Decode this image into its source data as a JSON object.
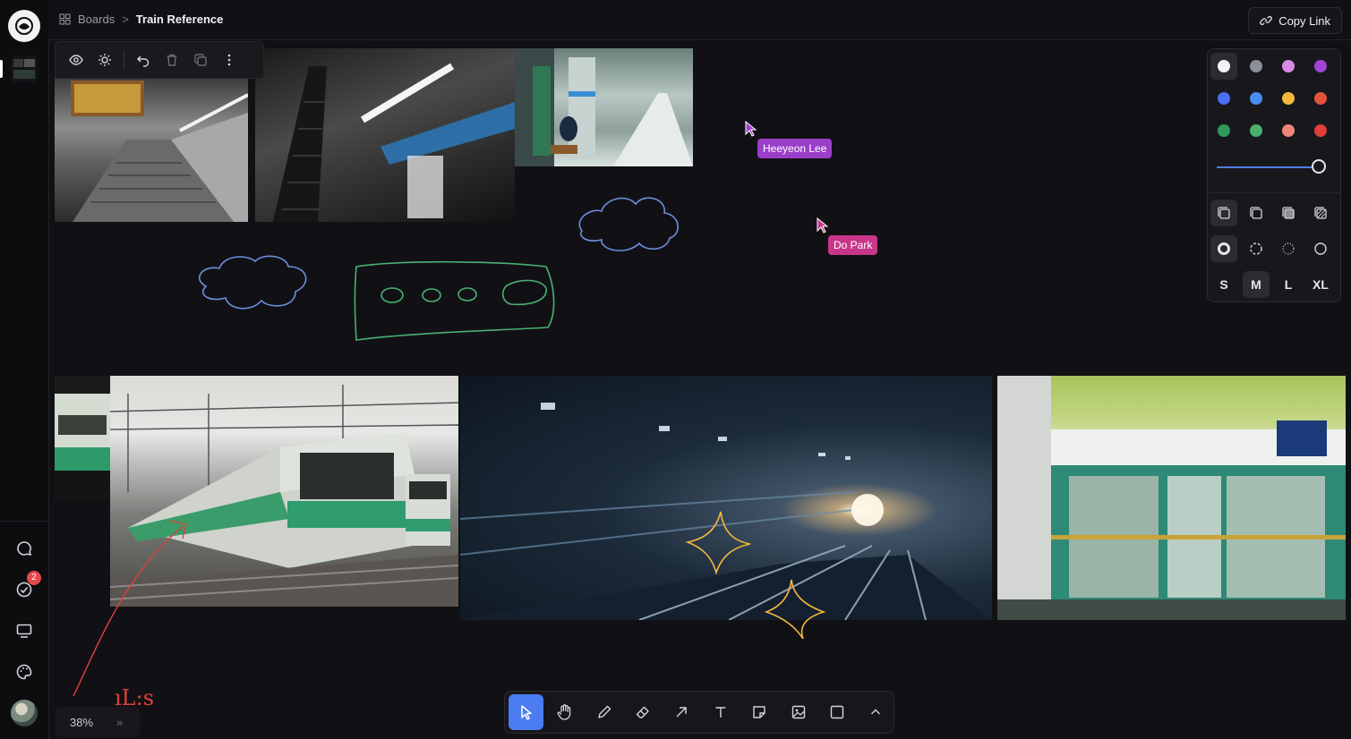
{
  "breadcrumb": {
    "root": "Boards",
    "separator": ">",
    "title": "Train Reference"
  },
  "header": {
    "copy_link": "Copy Link"
  },
  "rail": {
    "tasks_badge": "2"
  },
  "collaborators": [
    {
      "name": "Heeyeon Lee",
      "color": "#9b3fc9"
    },
    {
      "name": "Do Park",
      "color": "#c8368a"
    }
  ],
  "style_panel": {
    "colors": [
      "#f2f2f4",
      "#8b8f98",
      "#d78be6",
      "#a044d4",
      "#4b6ef2",
      "#4a8df2",
      "#f5b83d",
      "#e5533d",
      "#2f9a5b",
      "#49b070",
      "#ef8479",
      "#e0403a"
    ],
    "selected_color": "#f2f2f4",
    "opacity": 1.0,
    "sizes": [
      "S",
      "M",
      "L",
      "XL"
    ],
    "selected_size": "M"
  },
  "zoom": {
    "level": "38%"
  },
  "annotation": {
    "handwriting": "ıL:s"
  },
  "tools": [
    "select",
    "hand",
    "draw",
    "eraser",
    "arrow",
    "text",
    "note",
    "image",
    "rectangle",
    "more"
  ],
  "active_tool": "select"
}
